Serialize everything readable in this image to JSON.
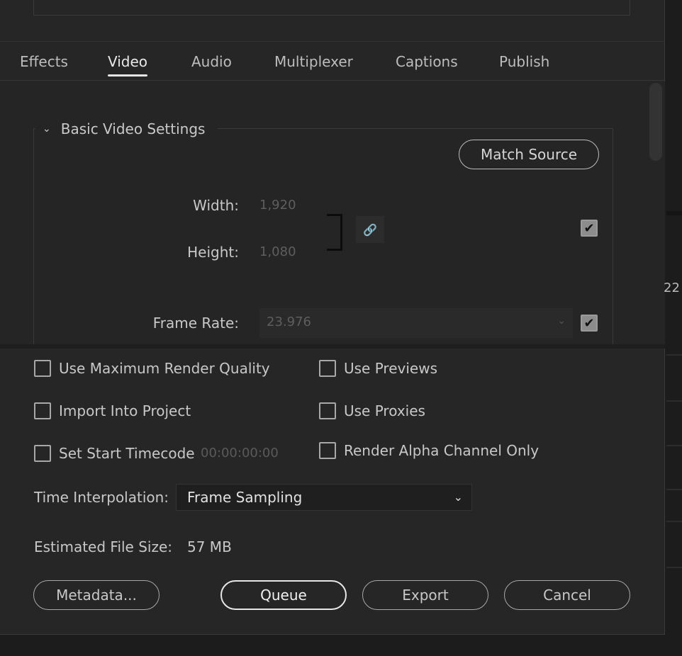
{
  "tabs": [
    {
      "label": "Effects"
    },
    {
      "label": "Video"
    },
    {
      "label": "Audio"
    },
    {
      "label": "Multiplexer"
    },
    {
      "label": "Captions"
    },
    {
      "label": "Publish"
    }
  ],
  "active_tab": "Video",
  "basic_video": {
    "title": "Basic Video Settings",
    "match_source": "Match Source",
    "width_label": "Width:",
    "width_value": "1,920",
    "height_label": "Height:",
    "height_value": "1,080",
    "frame_rate_label": "Frame Rate:",
    "frame_rate_value": "23.976",
    "size_checked": true,
    "frame_rate_checked": true
  },
  "options": {
    "max_render": "Use Maximum Render Quality",
    "use_previews": "Use Previews",
    "import_project": "Import Into Project",
    "use_proxies": "Use Proxies",
    "start_timecode": "Set Start Timecode",
    "timecode_value": "00:00:00:00",
    "alpha_only": "Render Alpha Channel Only"
  },
  "time_interpolation": {
    "label": "Time Interpolation:",
    "value": "Frame Sampling"
  },
  "file_size": {
    "label": "Estimated File Size:",
    "value": "57 MB"
  },
  "buttons": {
    "metadata": "Metadata...",
    "queue": "Queue",
    "export": "Export",
    "cancel": "Cancel"
  },
  "side_text": "22"
}
